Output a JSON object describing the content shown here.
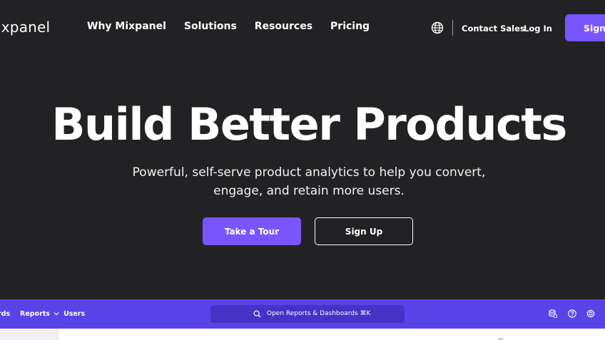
{
  "nav": {
    "logo": "ixpanel",
    "links": [
      "Why Mixpanel",
      "Solutions",
      "Resources",
      "Pricing"
    ],
    "globe_icon": "globe-icon",
    "contact_sales": "Contact Sales",
    "log_in": "Log In",
    "sign_up": "Sign Up"
  },
  "hero": {
    "title": "Build Better Products",
    "subtitle_line1": "Powerful, self-serve product analytics to help you convert,",
    "subtitle_line2": "engage, and retain more users.",
    "primary_cta": "Take a Tour",
    "secondary_cta": "Sign Up"
  },
  "app_preview": {
    "tabs": [
      "rds",
      "Reports",
      "Users"
    ],
    "reports_chevron": "chevron-down-icon",
    "search_placeholder": "Open Reports & Dashboards ⌘K",
    "right_icons": [
      "database-icon",
      "help-icon",
      "gear-icon"
    ]
  },
  "colors": {
    "background": "#222124",
    "accent": "#7856ff",
    "app_bar": "#5a43e6",
    "search_box": "#4731c7"
  }
}
